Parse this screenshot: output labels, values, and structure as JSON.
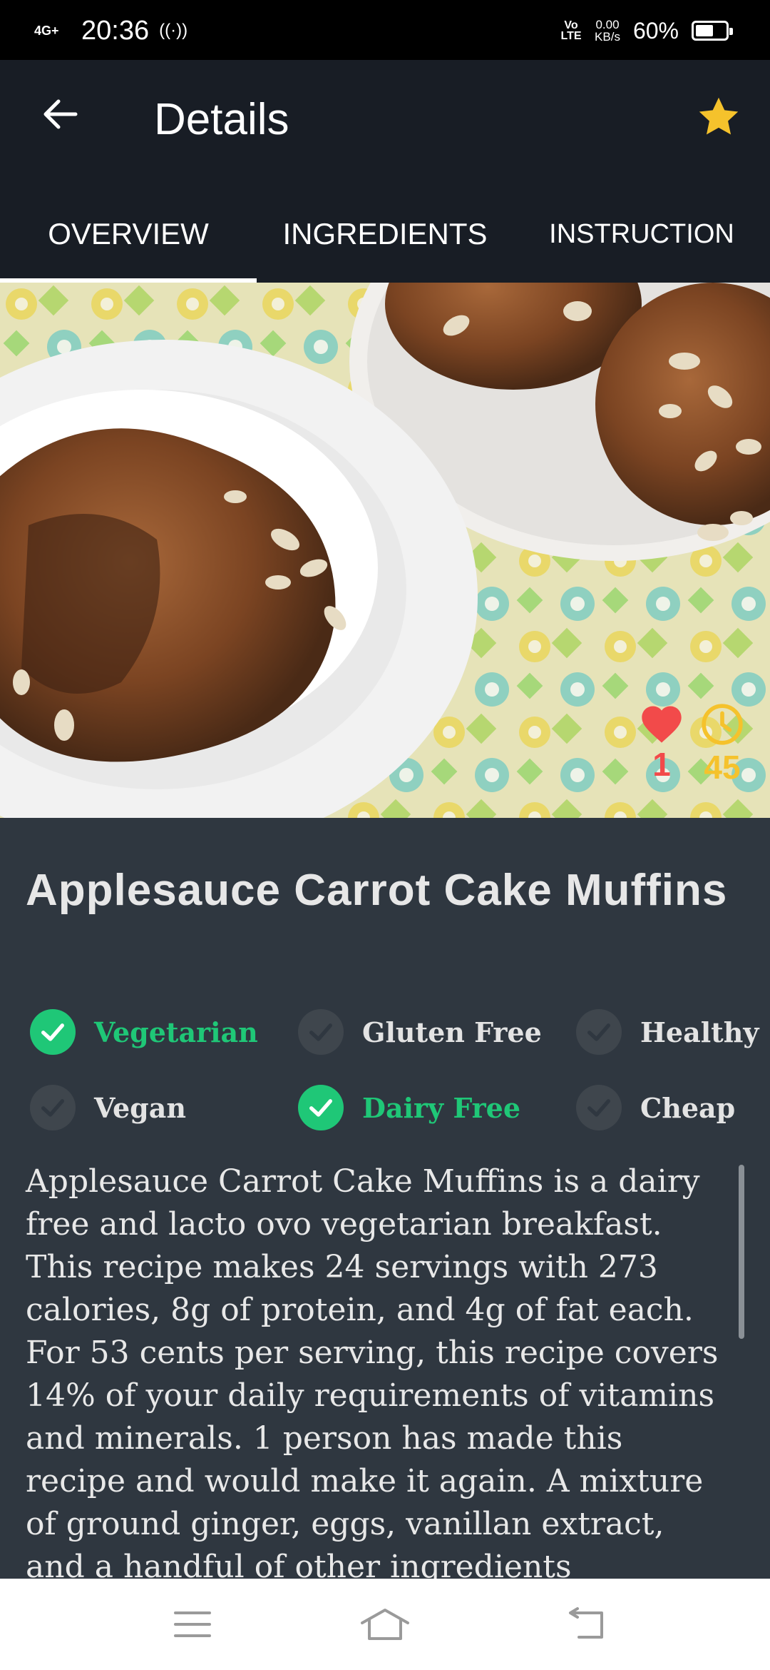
{
  "status_bar": {
    "network": "4G+",
    "time": "20:36",
    "hotspot_icon": "hotspot-icon",
    "volte": "Vo LTE",
    "speed_value": "0.00",
    "speed_unit": "KB/s",
    "battery_percent": "60%",
    "battery_level": 0.6
  },
  "app_bar": {
    "title": "Details",
    "back_icon": "arrow-left-icon",
    "favorite_icon": "star-icon",
    "favorite_color": "#F5C22C"
  },
  "tabs": [
    {
      "label": "OVERVIEW",
      "active": true
    },
    {
      "label": "INGREDIENTS",
      "active": false
    },
    {
      "label": "INSTRUCTION",
      "active": false
    }
  ],
  "hero": {
    "likes": "1",
    "likes_color": "#F24A4A",
    "minutes": "45",
    "minutes_color": "#F5C22C"
  },
  "recipe": {
    "title": "Applesauce Carrot Cake Muffins",
    "tags": [
      {
        "label": "Vegetarian",
        "checked": true
      },
      {
        "label": "Gluten Free",
        "checked": false
      },
      {
        "label": "Healthy",
        "checked": false
      },
      {
        "label": "Vegan",
        "checked": false
      },
      {
        "label": "Dairy Free",
        "checked": true
      },
      {
        "label": "Cheap",
        "checked": false
      }
    ],
    "description": "Applesauce Carrot Cake Muffins is a dairy free and lacto ovo vegetarian breakfast. This recipe makes 24 servings with 273 calories, 8g of protein, and 4g of fat each. For 53 cents per serving, this recipe covers 14% of your daily requirements of vitamins and minerals. 1 person has made this recipe and would make it again. A mixture of ground ginger, eggs, vanillan extract, and a handful of other ingredients",
    "accent_color": "#1FC777"
  },
  "nav_bar": {
    "menu_icon": "menu-icon",
    "home_icon": "home-icon",
    "back_icon": "back-icon"
  }
}
